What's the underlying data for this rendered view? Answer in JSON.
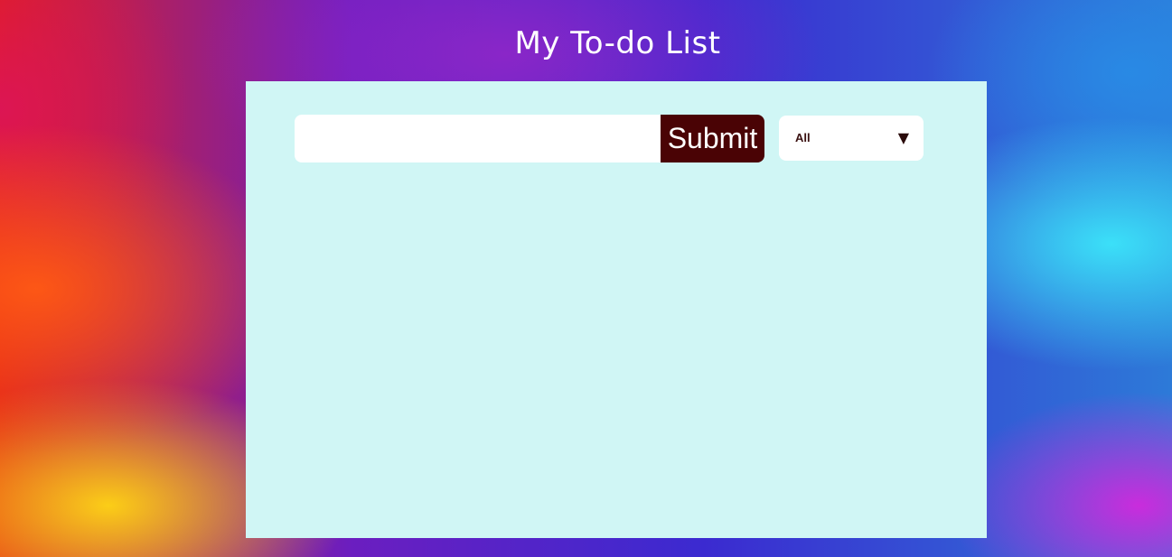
{
  "header": {
    "title": "My To-do List"
  },
  "form": {
    "input_value": "",
    "input_placeholder": "",
    "submit_label": "Submit"
  },
  "filter": {
    "selected": "All",
    "arrow_icon": "triangle-down-icon"
  },
  "todos": [],
  "colors": {
    "panel_background": "#d0f6f5",
    "submit_background": "#4a0305",
    "title_text": "#ffffff"
  }
}
